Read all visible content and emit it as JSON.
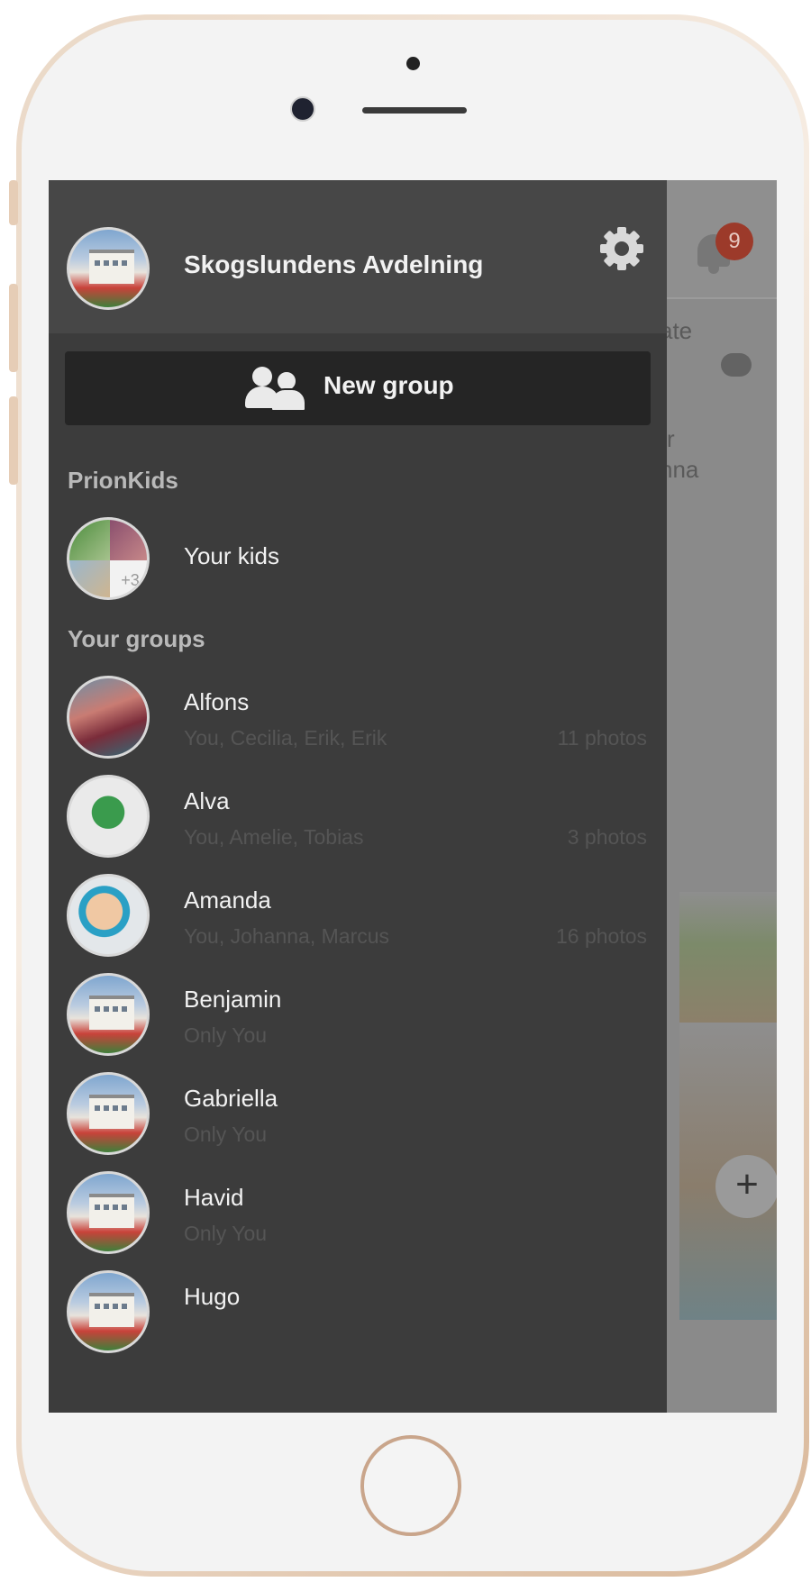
{
  "header": {
    "group_name": "Skogslundens Avdelning"
  },
  "new_group": {
    "label": "New group"
  },
  "sections": {
    "prionkids": "PrionKids",
    "your_groups": "Your groups"
  },
  "your_kids": {
    "label": "Your kids",
    "extra_count": "+3"
  },
  "groups": [
    {
      "name": "Alfons",
      "members": "You, Cecilia, Erik, Erik",
      "photos": "11 photos"
    },
    {
      "name": "Alva",
      "members": "You, Amelie, Tobias",
      "photos": "3 photos"
    },
    {
      "name": "Amanda",
      "members": "You, Johanna, Marcus",
      "photos": "16 photos"
    },
    {
      "name": "Benjamin",
      "members": "Only You",
      "photos": ""
    },
    {
      "name": "Gabriella",
      "members": "Only You",
      "photos": ""
    },
    {
      "name": "Havid",
      "members": "Only You",
      "photos": ""
    },
    {
      "name": "Hugo",
      "members": "",
      "photos": ""
    }
  ],
  "background": {
    "notification_count": "9",
    "partial_text_1": "ate",
    "partial_text_2": "r",
    "partial_text_3": "nna",
    "fab_symbol": "+"
  },
  "colors": {
    "drawer_bg": "#3c3c3c",
    "drawer_header_bg": "#474747",
    "new_group_bg": "#252525",
    "badge": "#d9472b"
  }
}
